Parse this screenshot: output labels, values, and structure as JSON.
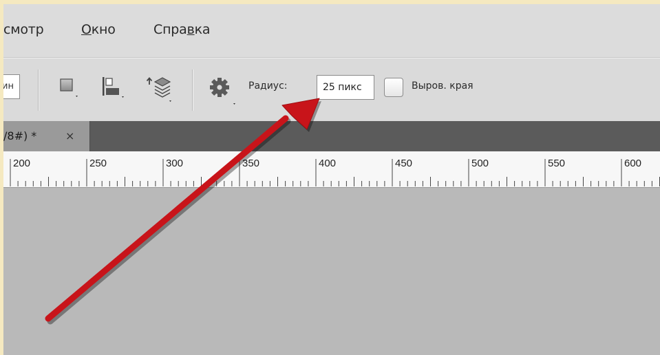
{
  "menubar": {
    "items": [
      {
        "label": "смотр"
      },
      {
        "label": "Окно",
        "mnemonic": "О",
        "rest": "кно"
      },
      {
        "label": "Справка",
        "prefix": "Спра",
        "mnemonic": "в",
        "rest": "ка"
      }
    ]
  },
  "options": {
    "cut_field_value": "ин",
    "radius_label": "Радиус:",
    "radius_value": "25 пикс",
    "antialias_label": "Выров. края",
    "antialias_checked": false
  },
  "icons": [
    "mode-square-icon",
    "align-edge-icon",
    "layers-sample-icon",
    "gear-icon"
  ],
  "tab": {
    "title": "/8#) *",
    "close": "×"
  },
  "ruler": {
    "labels": [
      "200",
      "250",
      "300",
      "350",
      "400",
      "450",
      "500",
      "550",
      "600"
    ]
  },
  "colors": {
    "annotation_arrow": "#c8141a",
    "menubar_bg": "#dcdcdc",
    "tabbar_bg": "#5b5b5b",
    "canvas_bg": "#b9b9b9"
  }
}
